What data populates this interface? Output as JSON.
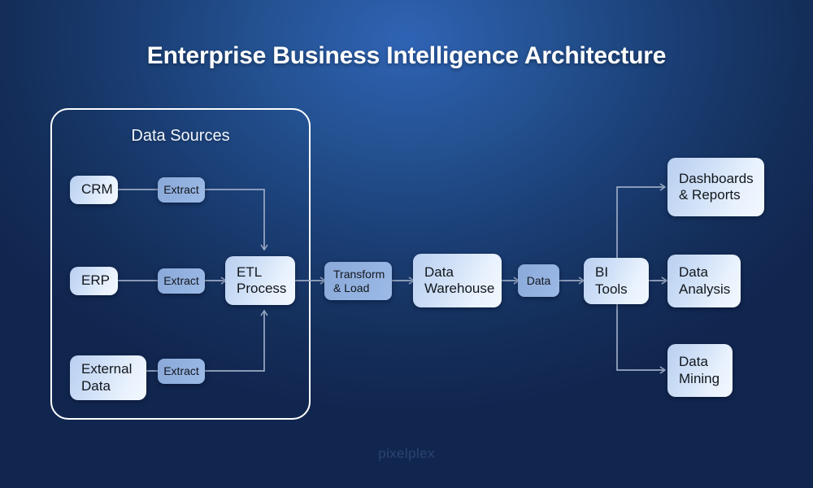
{
  "title": "Enterprise Business Intelligence Architecture",
  "watermark": "pixelplex",
  "groups": {
    "data_sources": {
      "label": "Data Sources"
    }
  },
  "nodes": {
    "crm": "CRM",
    "erp": "ERP",
    "external_data": "External\nData",
    "extract_crm": "Extract",
    "extract_erp": "Extract",
    "extract_external": "Extract",
    "etl_process": "ETL\nProcess",
    "transform_load": "Transform\n& Load",
    "data_warehouse": "Data\nWarehouse",
    "data": "Data",
    "bi_tools": "BI Tools",
    "dashboards_reports": "Dashboards\n& Reports",
    "data_analysis": "Data\nAnalysis",
    "data_mining": "Data\nMining"
  },
  "colors": {
    "background_dark": "#11264f",
    "background_highlight": "#2f63b4",
    "node_light": "#e8f1fd",
    "node_mid": "#93b2e0",
    "node_text": "#12161c",
    "connector": "#9aa9c4",
    "group_border": "#ffffff",
    "title_text": "#ffffff",
    "watermark_text": "#2c4272"
  }
}
